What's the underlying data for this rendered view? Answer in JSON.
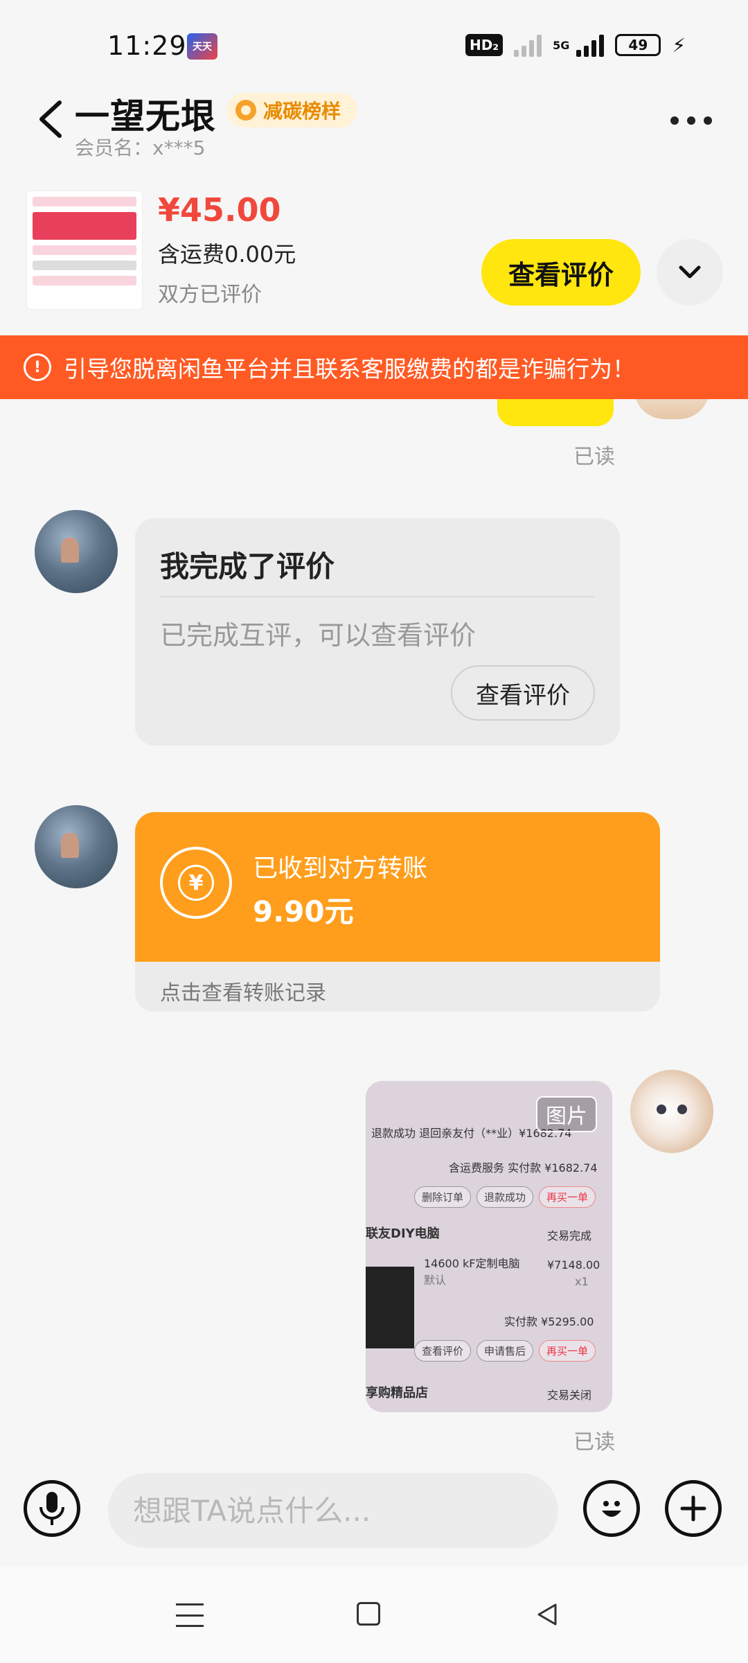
{
  "status_bar": {
    "time": "11:29",
    "app_icon_label": "天天",
    "hd_label": "HD₂",
    "network_label": "5G",
    "battery": "49"
  },
  "header": {
    "title": "一望无垠",
    "badge": "减碳榜样",
    "member": "会员名：x***5"
  },
  "product": {
    "price": "¥45.00",
    "shipping": "含运费0.00元",
    "review_status": "双方已评价",
    "view_review_button": "查看评价"
  },
  "warning": {
    "icon_text": "!",
    "text": "引导您脱离闲鱼平台并且联系客服缴费的都是诈骗行为！"
  },
  "messages": {
    "read_label_1": "已读",
    "review_card": {
      "title": "我完成了评价",
      "desc": "已完成互评，可以查看评价",
      "button": "查看评价"
    },
    "transfer_card": {
      "currency_symbol": "¥",
      "title": "已收到对方转账",
      "amount": "9.90元",
      "link": "点击查看转账记录"
    },
    "image_message": {
      "tag": "图片",
      "screenshot_lines": {
        "refund": "退款成功  退回亲友付（**业）¥1682.74",
        "paid": "含运费服务  实付款 ¥1682.74",
        "shop": "联友DIY电脑",
        "deal_done": "交易完成",
        "product": "14600 kF定制电脑",
        "default": "默认",
        "item_price": "¥7148.00",
        "qty": "x1",
        "paid2": "实付款 ¥5295.00",
        "shop2": "享购精品店",
        "deal_closed": "交易关闭"
      },
      "pills": {
        "delete_order": "删除订单",
        "refund_success": "退款成功",
        "rebuy": "再买一单",
        "view_review": "查看评价",
        "after_sale": "申请售后",
        "rebuy2": "再买一单"
      }
    },
    "read_label_2": "已读"
  },
  "input_bar": {
    "placeholder": "想跟TA说点什么..."
  },
  "colors": {
    "accent_yellow": "#ffe60f",
    "warning_orange": "#ff5a24",
    "transfer_orange": "#ff9e1c",
    "price_red": "#f0483c"
  },
  "icons": {
    "back": "chevron-left-icon",
    "more": "more-dots-icon",
    "expand": "chevron-down-icon",
    "mic": "microphone-icon",
    "emoji": "smile-icon",
    "plus": "plus-icon"
  }
}
